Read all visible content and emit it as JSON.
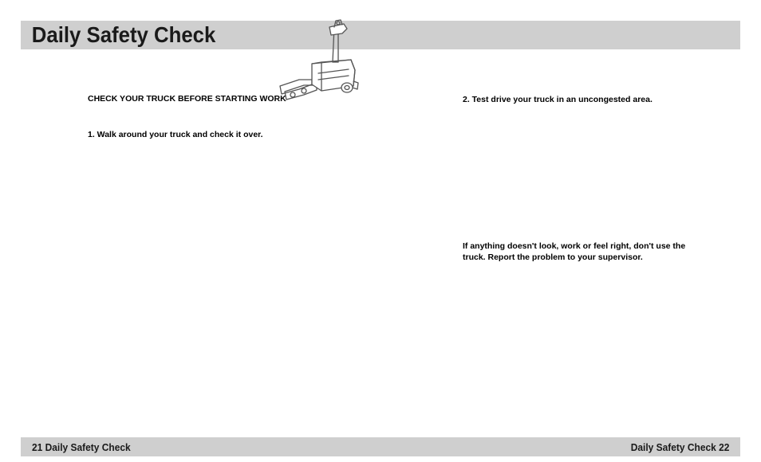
{
  "header": {
    "title": "Daily Safety Check"
  },
  "left": {
    "subhead": "CHECK YOUR TRUCK BEFORE STARTING WORK",
    "step1": "1.  Walk around your truck and check it over."
  },
  "right": {
    "step2": "2. Test drive your truck in an uncongested area.",
    "warning": "If anything doesn't look, work or feel right, don't use the truck. Report the problem to your supervisor."
  },
  "footer": {
    "left": "21   Daily Safety Check",
    "right": "Daily Safety Check   22"
  }
}
